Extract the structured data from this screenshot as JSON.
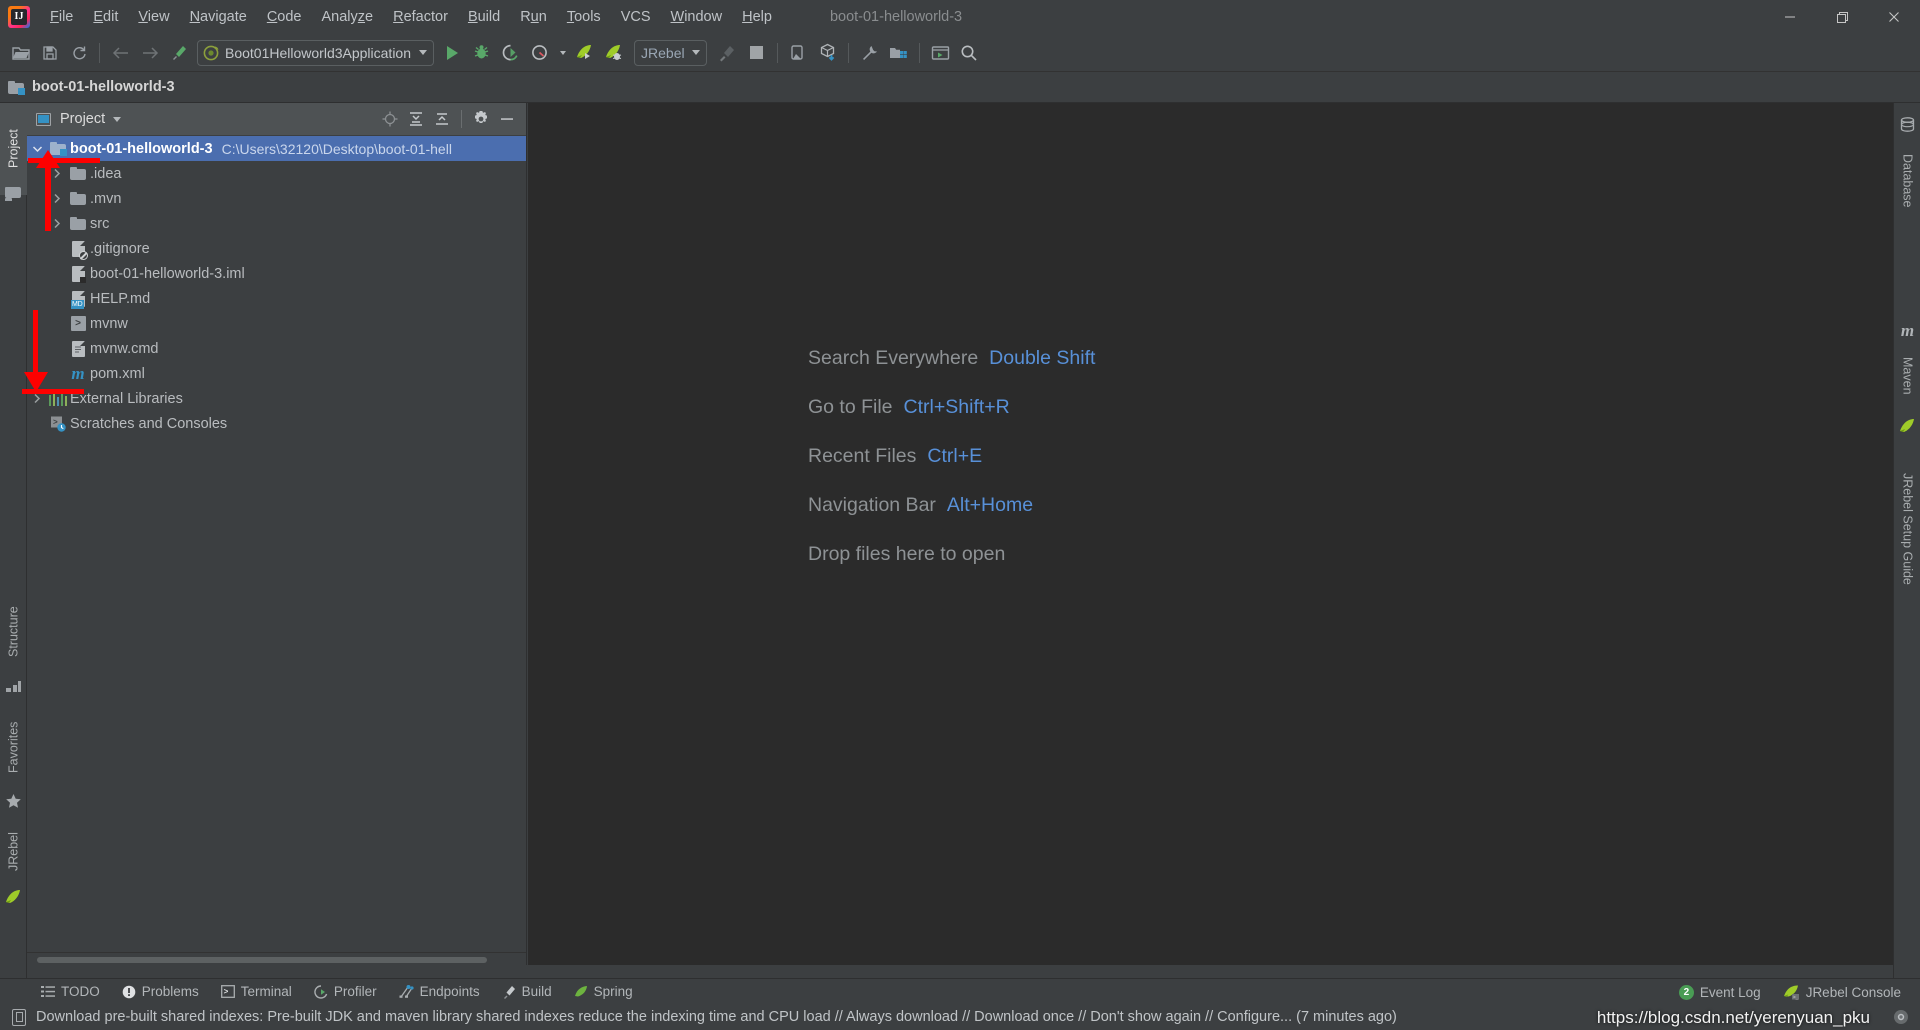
{
  "window": {
    "title": "boot-01-helloworld-3",
    "logo_icon": "intellij-idea-logo",
    "minimize_label": "—",
    "restore_label": "❐",
    "close_label": "✕"
  },
  "menu": [
    {
      "label": "File",
      "mnemonic": "F"
    },
    {
      "label": "Edit",
      "mnemonic": "E"
    },
    {
      "label": "View",
      "mnemonic": "V"
    },
    {
      "label": "Navigate",
      "mnemonic": "N"
    },
    {
      "label": "Code",
      "mnemonic": "C"
    },
    {
      "label": "Analyze",
      "mnemonic": "z"
    },
    {
      "label": "Refactor",
      "mnemonic": "R"
    },
    {
      "label": "Build",
      "mnemonic": "B"
    },
    {
      "label": "Run",
      "mnemonic": "u"
    },
    {
      "label": "Tools",
      "mnemonic": "T"
    },
    {
      "label": "VCS",
      "mnemonic": ""
    },
    {
      "label": "Window",
      "mnemonic": "W"
    },
    {
      "label": "Help",
      "mnemonic": "H"
    }
  ],
  "toolbar": {
    "open_icon": "open-folder-icon",
    "save_icon": "save-all-icon",
    "sync_icon": "refresh-icon",
    "back_icon": "navigate-back-icon",
    "forward_icon": "navigate-forward-icon",
    "build_icon": "build-hammer-icon",
    "run_config": {
      "value": "Boot01Helloworld3Application",
      "icon": "spring-boot-run-config-icon",
      "dropdown_icon": "chevron-down-icon"
    },
    "run_icon": "run-icon",
    "debug_icon": "debug-icon",
    "run_coverage_icon": "run-with-coverage-icon",
    "profiler_icon": "profiler-icon",
    "jrebel_run_icon": "jrebel-run-icon",
    "jrebel_debug_icon": "jrebel-debug-icon",
    "jrebel_select": {
      "value": "JRebel",
      "dropdown_icon": "chevron-down-icon"
    },
    "build_project_icon": "build-project-icon",
    "stop_icon": "stop-icon",
    "device_icon": "device-manager-icon",
    "sdk_icon": "sdk-download-icon",
    "settings_icon": "wrench-settings-icon",
    "project_structure_icon": "project-structure-icon",
    "terminal_icon": "run-anything-icon",
    "search_icon": "search-everywhere-icon"
  },
  "navbar": {
    "crumb_icon": "module-folder-icon",
    "crumb": "boot-01-helloworld-3"
  },
  "left_stripe": [
    {
      "label": "Project",
      "icon": "project-icon",
      "active": true
    },
    {
      "label": "Structure",
      "icon": "structure-icon",
      "active": false
    },
    {
      "label": "Favorites",
      "icon": "star-icon",
      "active": false
    },
    {
      "label": "JRebel",
      "icon": "jrebel-icon",
      "active": false
    }
  ],
  "right_stripe": [
    {
      "label": "Database",
      "icon": "database-icon"
    },
    {
      "label": "Maven",
      "icon": "maven-m-icon"
    },
    {
      "label": "JRebel Setup Guide",
      "icon": "jrebel-icon"
    }
  ],
  "project_panel": {
    "window_icon": "project-view-icon",
    "title": "Project",
    "title_dropdown_icon": "chevron-down-icon",
    "actions": [
      {
        "name": "scroll-from-source-icon",
        "label": ""
      },
      {
        "name": "expand-all-icon",
        "label": ""
      },
      {
        "name": "collapse-all-icon",
        "label": ""
      },
      {
        "name": "gear-icon",
        "label": ""
      },
      {
        "name": "hide-icon",
        "label": "—"
      }
    ],
    "tree": [
      {
        "name": "boot-01-helloworld-3",
        "path": "C:\\Users\\32120\\Desktop\\boot-01-hell",
        "icon": "module-folder-icon",
        "indent": 0,
        "chevron": "open",
        "selected": true
      },
      {
        "name": ".idea",
        "path": "",
        "icon": "folder-icon",
        "indent": 1,
        "chevron": "closed",
        "selected": false
      },
      {
        "name": ".mvn",
        "path": "",
        "icon": "folder-icon",
        "indent": 1,
        "chevron": "closed",
        "selected": false
      },
      {
        "name": "src",
        "path": "",
        "icon": "folder-icon",
        "indent": 1,
        "chevron": "closed",
        "selected": false
      },
      {
        "name": ".gitignore",
        "path": "",
        "icon": "gitignore-file-icon",
        "indent": 1,
        "chevron": "none",
        "selected": false
      },
      {
        "name": "boot-01-helloworld-3.iml",
        "path": "",
        "icon": "iml-file-icon",
        "indent": 1,
        "chevron": "none",
        "selected": false
      },
      {
        "name": "HELP.md",
        "path": "",
        "icon": "markdown-file-icon",
        "indent": 1,
        "chevron": "none",
        "selected": false
      },
      {
        "name": "mvnw",
        "path": "",
        "icon": "shell-script-icon",
        "indent": 1,
        "chevron": "none",
        "selected": false
      },
      {
        "name": "mvnw.cmd",
        "path": "",
        "icon": "cmd-file-icon",
        "indent": 1,
        "chevron": "none",
        "selected": false
      },
      {
        "name": "pom.xml",
        "path": "",
        "icon": "maven-pom-icon",
        "indent": 1,
        "chevron": "none",
        "selected": false
      },
      {
        "name": "External Libraries",
        "path": "",
        "icon": "libraries-icon",
        "indent": 0,
        "chevron": "closed",
        "selected": false
      },
      {
        "name": "Scratches and Consoles",
        "path": "",
        "icon": "scratches-icon",
        "indent": 0,
        "chevron": "none",
        "selected": false
      }
    ]
  },
  "editor_tips": [
    {
      "label": "Search Everywhere",
      "key": "Double Shift"
    },
    {
      "label": "Go to File",
      "key": "Ctrl+Shift+R"
    },
    {
      "label": "Recent Files",
      "key": "Ctrl+E"
    },
    {
      "label": "Navigation Bar",
      "key": "Alt+Home"
    },
    {
      "label": "Drop files here to open",
      "key": ""
    }
  ],
  "bottom_bar": {
    "left": [
      {
        "label": "TODO",
        "icon": "todo-list-icon"
      },
      {
        "label": "Problems",
        "icon": "problems-warning-icon"
      },
      {
        "label": "Terminal",
        "icon": "terminal-icon"
      },
      {
        "label": "Profiler",
        "icon": "profiler-icon"
      },
      {
        "label": "Endpoints",
        "icon": "endpoints-icon"
      },
      {
        "label": "Build",
        "icon": "build-hammer-icon"
      },
      {
        "label": "Spring",
        "icon": "spring-leaf-icon"
      }
    ],
    "right": [
      {
        "label": "Event Log",
        "icon": "event-log-icon",
        "badge": "2"
      },
      {
        "label": "JRebel Console",
        "icon": "jrebel-console-icon",
        "badge": ""
      }
    ]
  },
  "status_bar": {
    "icon": "notification-icon",
    "message": "Download pre-built shared indexes: Pre-built JDK and maven library shared indexes reduce the indexing time and CPU load // Always download // Download once // Don't show again // Configure... (7 minutes ago)",
    "gear_icon": "settings-gear-icon"
  },
  "watermark": "https://blog.csdn.net/yerenyuan_pku",
  "colors": {
    "accent_blue": "#5890d8",
    "selection_blue": "#4b6eaf",
    "panel_bg": "#3c3f41",
    "editor_bg": "#2b2b2b",
    "annotation_red": "#fe0000",
    "green_run": "#59a869"
  }
}
